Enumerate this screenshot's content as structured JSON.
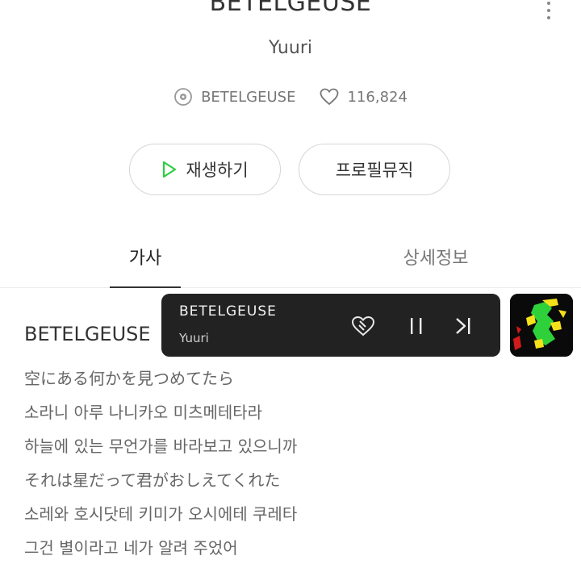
{
  "song": {
    "title": "BETELGEUSE",
    "artist": "Yuuri"
  },
  "meta": {
    "album": "BETELGEUSE",
    "likes": "116,824"
  },
  "actions": {
    "play_label": "재생하기",
    "profile_music_label": "프로필뮤직"
  },
  "tabs": [
    {
      "label": "가사",
      "active": true
    },
    {
      "label": "상세정보",
      "active": false
    }
  ],
  "lyrics": {
    "title": "BETELGEUSE",
    "lines": [
      "空にある何かを見つめてたら",
      "소라니 아루 나니카오 미츠메테타라",
      "하늘에 있는 무언가를 바라보고 있으니까",
      "それは星だって君がおしえてくれた",
      "소레와 호시닷테 키미가 오시에테 쿠레타",
      "그건 별이라고 네가 알려 주었어"
    ]
  },
  "mini_player": {
    "title": "BETELGEUSE",
    "artist": "Yuuri"
  },
  "colors": {
    "accent_play": "#2ecc40",
    "mini_player_bg": "#222222"
  },
  "icons": {
    "album": "disc-icon",
    "likes": "heart-outline-icon",
    "play": "play-icon",
    "more": "more-vertical-icon",
    "mini_like": "heart-broken-icon",
    "mini_pause": "pause-icon",
    "mini_next": "skip-next-icon"
  }
}
